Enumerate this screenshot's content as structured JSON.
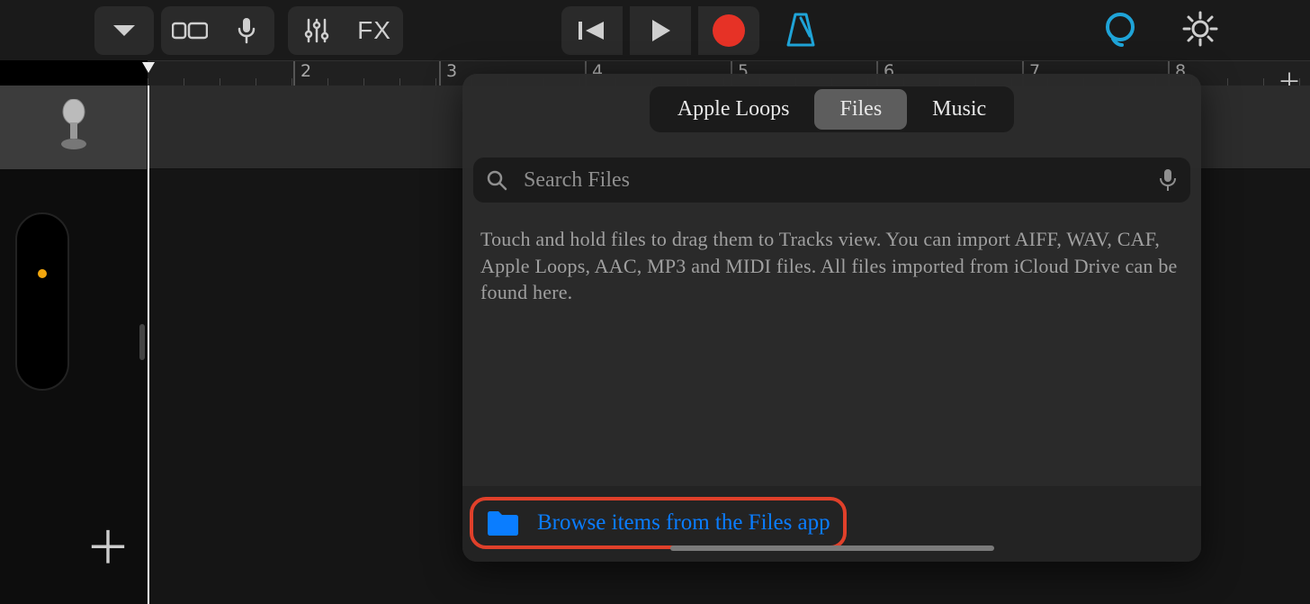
{
  "toolbar": {
    "fx_label": "FX"
  },
  "ruler": {
    "marks": [
      "2",
      "3",
      "4",
      "5",
      "6",
      "7",
      "8"
    ]
  },
  "popover": {
    "tabs": {
      "loops": "Apple Loops",
      "files": "Files",
      "music": "Music"
    },
    "search_placeholder": "Search Files",
    "hint": "Touch and hold files to drag them to Tracks view. You can import AIFF, WAV, CAF, Apple Loops, AAC, MP3 and MIDI files. All files imported from iCloud Drive can be found here.",
    "browse_label": "Browse items from the Files app"
  },
  "colors": {
    "accent": "#0a7dff",
    "record": "#e63226",
    "metronome": "#1fa4d8",
    "highlight_border": "#e0402a"
  }
}
